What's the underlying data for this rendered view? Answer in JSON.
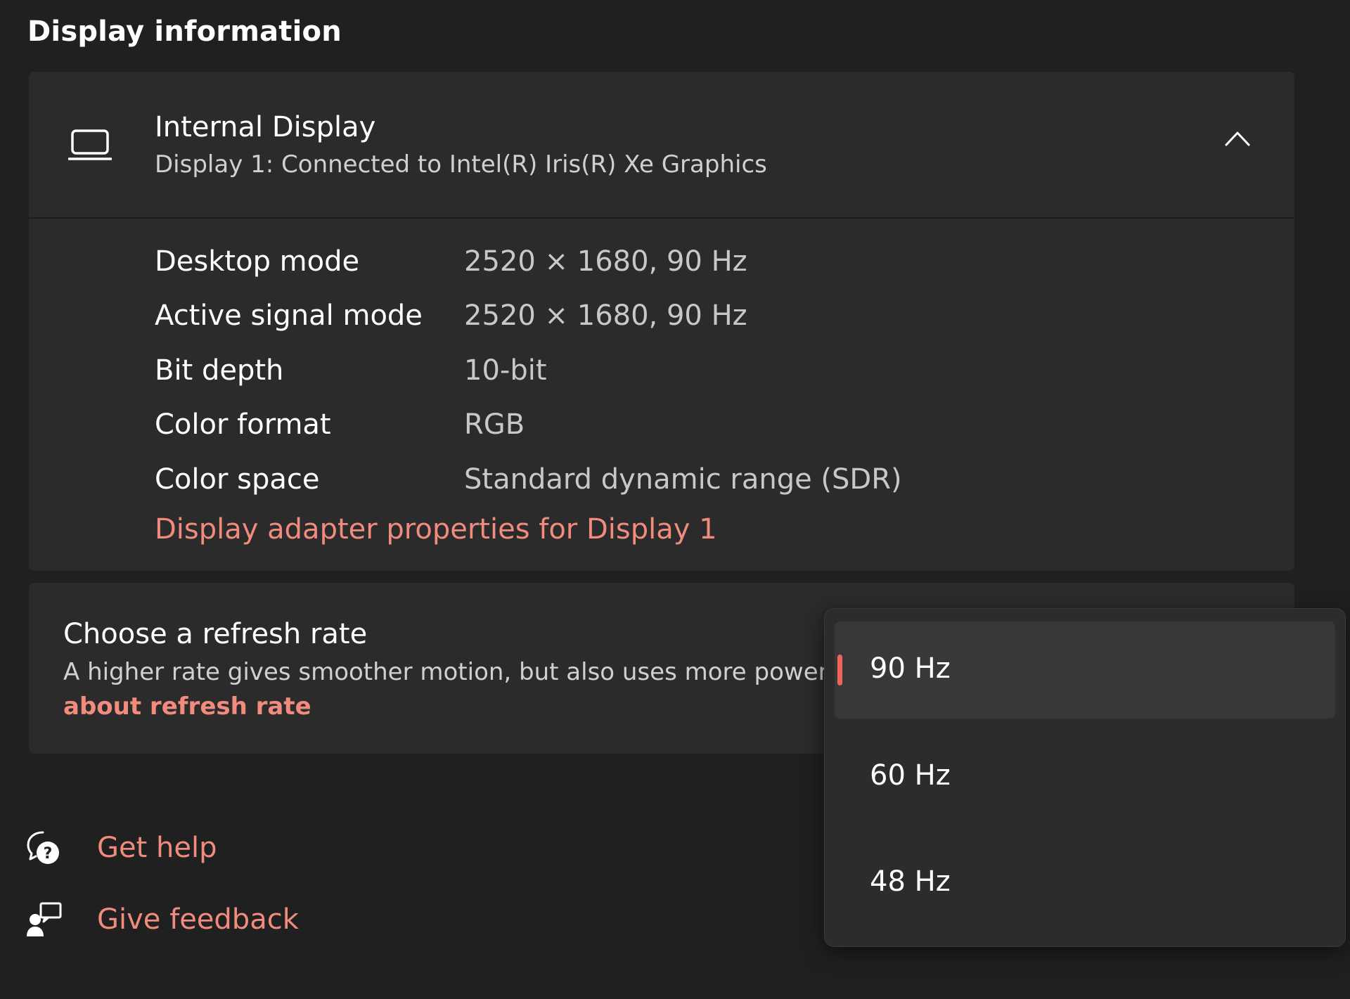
{
  "section": {
    "title": "Display information"
  },
  "display": {
    "name": "Internal Display",
    "subtitle": "Display 1: Connected to Intel(R) Iris(R) Xe Graphics",
    "icon": "laptop-icon",
    "expand_icon": "chevron-up-icon",
    "info": [
      {
        "label": "Desktop mode",
        "value": "2520 × 1680, 90 Hz"
      },
      {
        "label": "Active signal mode",
        "value": "2520 × 1680, 90 Hz"
      },
      {
        "label": "Bit depth",
        "value": "10-bit"
      },
      {
        "label": "Color format",
        "value": "RGB"
      },
      {
        "label": "Color space",
        "value": "Standard dynamic range (SDR)"
      }
    ],
    "adapter_link": "Display adapter properties for Display 1"
  },
  "refresh": {
    "title": "Choose a refresh rate",
    "description": "A higher rate gives smoother motion, but also uses more power",
    "link": "about refresh rate",
    "selected": "90 Hz",
    "options": [
      "90 Hz",
      "60 Hz",
      "48 Hz"
    ]
  },
  "footer": {
    "help": "Get help",
    "feedback": "Give feedback"
  },
  "colors": {
    "background": "#202020",
    "card": "#2b2b2b",
    "accent": "#f08b7e",
    "selected_indicator": "#f0645a"
  }
}
